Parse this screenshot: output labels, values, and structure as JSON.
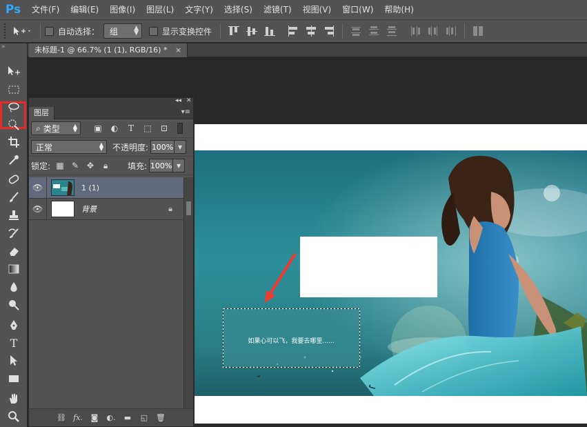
{
  "app": {
    "logo_text": "Ps"
  },
  "menu": [
    "文件(F)",
    "编辑(E)",
    "图像(I)",
    "图层(L)",
    "文字(Y)",
    "选择(S)",
    "滤镜(T)",
    "视图(V)",
    "窗口(W)",
    "帮助(H)"
  ],
  "options": {
    "auto_select_label": "自动选择：",
    "auto_select_value": "组",
    "show_transform_label": "显示变换控件"
  },
  "document": {
    "tab_title": "未标题-1 @ 66.7% (1 (1), RGB/16) *",
    "close_glyph": "×",
    "photo_caption": "如果心可以飞，我要去哪里......"
  },
  "layers_panel": {
    "title": "图层",
    "filter_label": "类型",
    "blend_mode": "正常",
    "opacity_label": "不透明度:",
    "opacity_value": "100%",
    "lock_label": "锁定:",
    "fill_label": "填充:",
    "fill_value": "100%",
    "layers": [
      {
        "name": "1 (1)",
        "selected": true,
        "locked": false
      },
      {
        "name": "背景",
        "selected": false,
        "locked": true
      }
    ]
  },
  "colors": {
    "ps_blue": "#31a8ff",
    "highlight_red": "#ea2a2a",
    "arrow_red": "#f03a2e",
    "panel_bg": "#535353",
    "workspace_bg": "#282828"
  }
}
